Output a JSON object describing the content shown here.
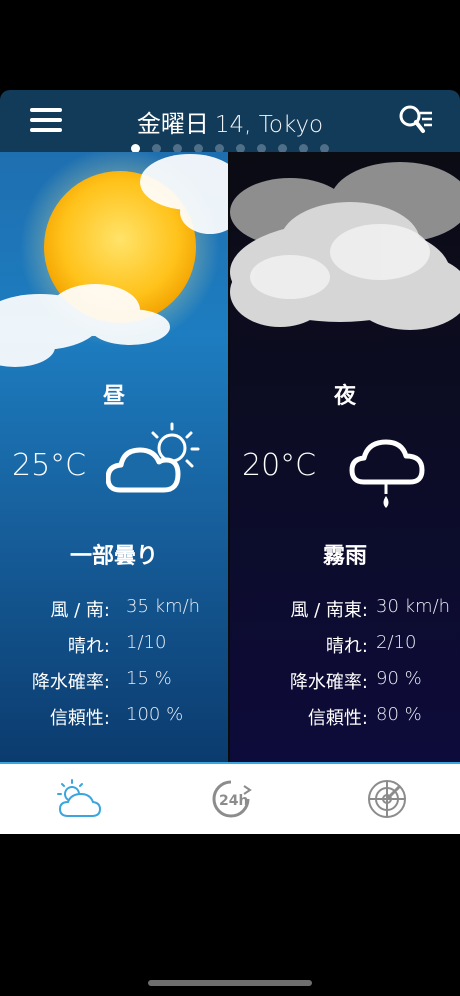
{
  "header": {
    "day": "金曜日",
    "date_city": "14, Tokyo",
    "page_count": 10,
    "active_page": 0
  },
  "day_panel": {
    "label": "昼",
    "temperature": "25°C",
    "condition": "一部曇り",
    "icon": "partly-cloudy-sun-icon",
    "stats": [
      {
        "key": "風 / 南:",
        "value": "35 km/h"
      },
      {
        "key": "晴れ:",
        "value": "1/10"
      },
      {
        "key": "降水確率:",
        "value": "15 %"
      },
      {
        "key": "信頼性:",
        "value": "100 %"
      }
    ]
  },
  "night_panel": {
    "label": "夜",
    "temperature": "20°C",
    "condition": "霧雨",
    "icon": "drizzle-cloud-icon",
    "stats": [
      {
        "key": "風 / 南東:",
        "value": "30 km/h"
      },
      {
        "key": "晴れ:",
        "value": "2/10"
      },
      {
        "key": "降水確率:",
        "value": "90 %"
      },
      {
        "key": "信頼性:",
        "value": "80 %"
      }
    ]
  },
  "tabs": [
    {
      "icon": "weather-forecast-icon",
      "active": true
    },
    {
      "icon": "24h-forecast-icon",
      "active": false
    },
    {
      "icon": "radar-icon",
      "active": false
    }
  ],
  "colors": {
    "header_bg": "#123a59",
    "active_tab": "#3aa6dd",
    "inactive_tab": "#8c8c8c"
  }
}
